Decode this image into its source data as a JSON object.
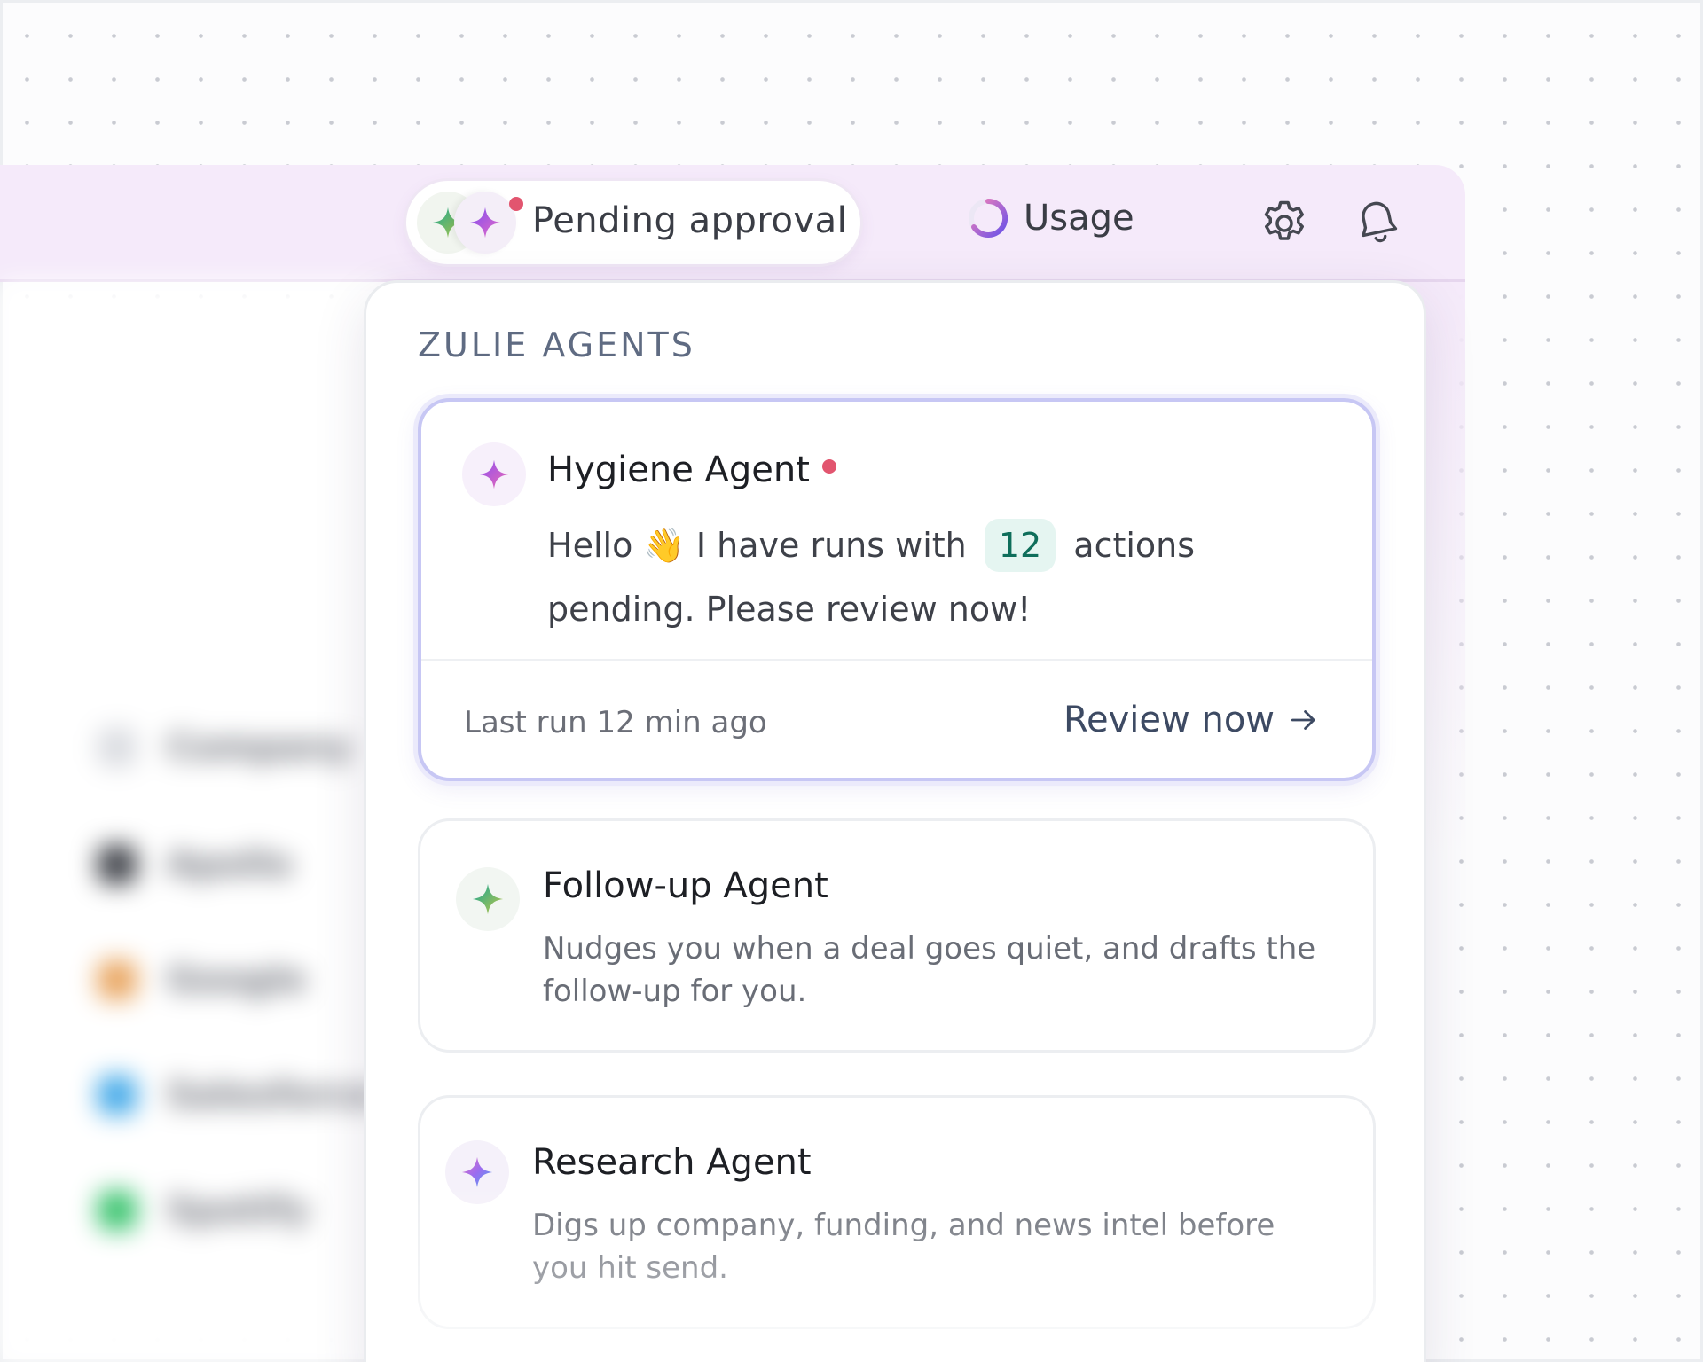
{
  "header": {
    "pending_label": "Pending approval",
    "usage_label": "Usage"
  },
  "sidebar": {
    "items": [
      {
        "label": "Company",
        "color": "#d9dbe0"
      },
      {
        "label": "Apollo",
        "color": "#3b3e45"
      },
      {
        "label": "Google",
        "color": "#e8a25a"
      },
      {
        "label": "Salesforce",
        "color": "#3ea7e8"
      },
      {
        "label": "Spotify",
        "color": "#34c26a"
      }
    ]
  },
  "panel": {
    "title": "ZULIE AGENTS",
    "agents": [
      {
        "name": "Hygiene Agent",
        "message_pre": "Hello",
        "wave": "👋",
        "message_mid": "I have runs with",
        "count": "12",
        "message_post": "actions pending. Please review now!",
        "last_run": "Last run 12 min ago",
        "action_label": "Review now"
      },
      {
        "name": "Follow-up Agent",
        "description": "Nudges you when a deal goes quiet, and drafts the follow-up for you."
      },
      {
        "name": "Research Agent",
        "description": "Digs up company, funding, and news intel before you hit send."
      }
    ]
  },
  "colors": {
    "accent_pink": "#e2556f",
    "header_band": "#f5eafa",
    "active_card_border": "#c7c7f4",
    "badge_bg": "#e5f5f1",
    "badge_text": "#0f6e5b"
  }
}
